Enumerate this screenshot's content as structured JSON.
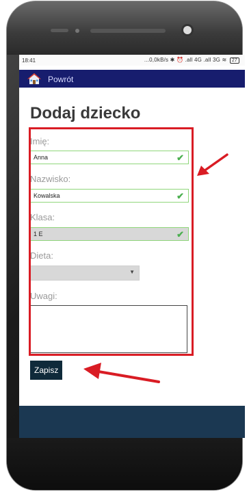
{
  "status_bar": {
    "time": "18:41",
    "indicators": "...0,0kB/s ✱ ⏰ .all 4G .all 3G ≋",
    "battery": "27"
  },
  "nav": {
    "home_icon": "home-icon",
    "back_label": "Powrót"
  },
  "page": {
    "title": "Dodaj dziecko"
  },
  "form": {
    "first_name_label": "Imię:",
    "first_name_value": "Anna",
    "last_name_label": "Nazwisko:",
    "last_name_value": "Kowalska",
    "class_label": "Klasa:",
    "class_value": "1 E",
    "diet_label": "Dieta:",
    "diet_value": "",
    "notes_label": "Uwagi:",
    "notes_value": "",
    "save_label": "Zapisz"
  },
  "colors": {
    "navbar": "#171d6e",
    "highlight": "#d91c24",
    "valid_border": "#8fd67a",
    "save_button": "#0f2a3a",
    "footer_band": "#1b3852"
  }
}
